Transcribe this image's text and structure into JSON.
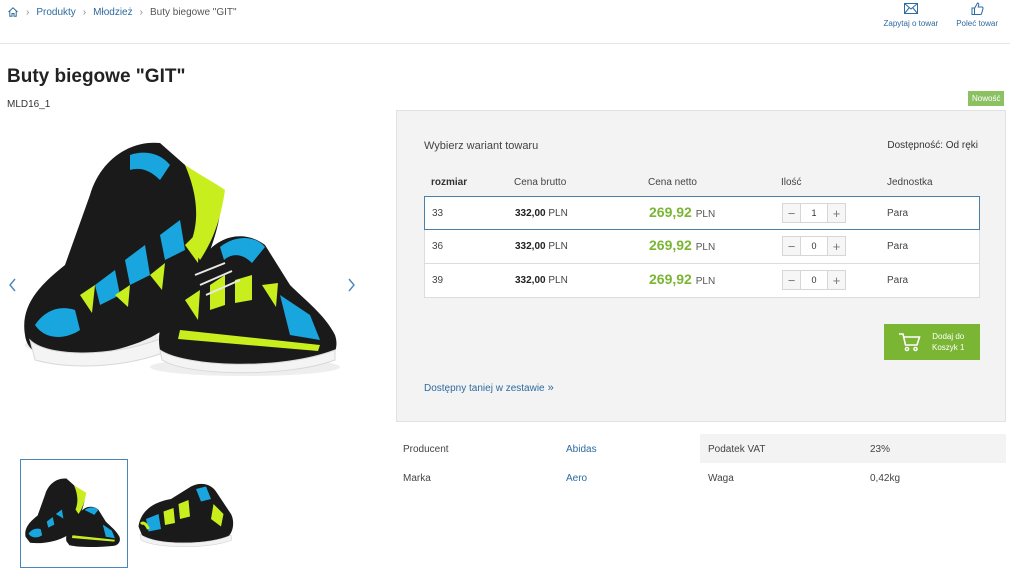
{
  "breadcrumb": {
    "items": [
      "Produkty",
      "Młodzież"
    ],
    "current": "Buty biegowe \"GIT\""
  },
  "top_actions": {
    "ask": "Zapytaj o towar",
    "recommend": "Poleć towar"
  },
  "product": {
    "title": "Buty biegowe \"GIT\"",
    "sku": "MLD16_1",
    "badge": "Nowość"
  },
  "variants": {
    "heading": "Wybierz wariant towaru",
    "availability": "Dostępność: Od ręki",
    "columns": {
      "size": "rozmiar",
      "gross": "Cena brutto",
      "net": "Cena netto",
      "qty": "Ilość",
      "unit": "Jednostka"
    },
    "rows": [
      {
        "size": "33",
        "gross": "332,00",
        "net": "269,92",
        "currency": "PLN",
        "qty": "1",
        "unit": "Para"
      },
      {
        "size": "36",
        "gross": "332,00",
        "net": "269,92",
        "currency": "PLN",
        "qty": "0",
        "unit": "Para"
      },
      {
        "size": "39",
        "gross": "332,00",
        "net": "269,92",
        "currency": "PLN",
        "qty": "0",
        "unit": "Para"
      }
    ],
    "cart_button": {
      "line1": "Dodaj do",
      "line2": "Koszyk 1"
    },
    "bundle_link": "Dostępny taniej w zestawie"
  },
  "attributes": [
    {
      "k1": "Producent",
      "v1": "Abidas",
      "k2": "Podatek VAT",
      "v2": "23%"
    },
    {
      "k1": "Marka",
      "v1": "Aero",
      "k2": "Waga",
      "v2": "0,42kg"
    }
  ],
  "colors": {
    "accent_green": "#7ab534",
    "link_blue": "#2d6a9f",
    "badge_green": "#8cc163"
  }
}
